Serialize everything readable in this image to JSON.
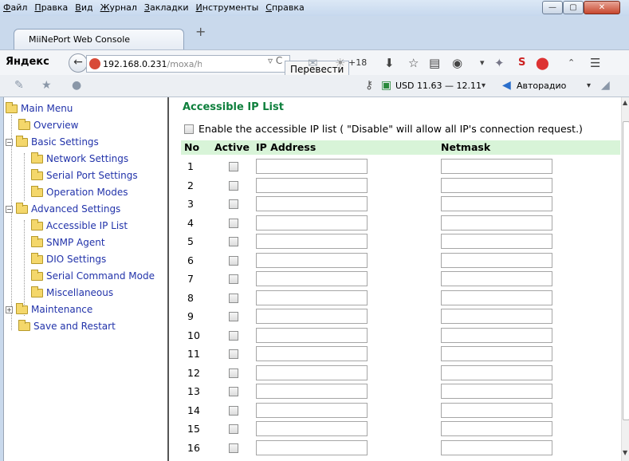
{
  "menu": [
    "Файл",
    "Правка",
    "Вид",
    "Журнал",
    "Закладки",
    "Инструменты",
    "Справка"
  ],
  "window_buttons": {
    "minimize": "—",
    "maximize": "▢",
    "close": "✕"
  },
  "tab": {
    "title": "MiiNePort Web Console",
    "new_tab": "+"
  },
  "nav": {
    "brand": "Яндекс",
    "url_host": "192.168.0.231",
    "url_path": "/moxa/h",
    "translate": "Перевести",
    "reload": "▿ C",
    "weather": "+18"
  },
  "toolbar2": {
    "currency": "USD 11.63 — 12.11",
    "radio": "Авторадио"
  },
  "sidebar": {
    "items": [
      {
        "label": "Main Menu"
      },
      {
        "label": "Overview"
      },
      {
        "label": "Basic Settings"
      },
      {
        "label": "Network Settings"
      },
      {
        "label": "Serial Port Settings"
      },
      {
        "label": "Operation Modes"
      },
      {
        "label": "Advanced Settings"
      },
      {
        "label": "Accessible IP List"
      },
      {
        "label": "SNMP Agent"
      },
      {
        "label": "DIO Settings"
      },
      {
        "label": "Serial Command Mode"
      },
      {
        "label": "Miscellaneous"
      },
      {
        "label": "Maintenance"
      },
      {
        "label": "Save and Restart"
      }
    ]
  },
  "main": {
    "title": "Accessible IP List",
    "enable_label": "Enable the accessible IP list ( \"Disable\" will allow all IP's connection request.)",
    "columns": {
      "no": "No",
      "active": "Active",
      "ip": "IP Address",
      "mask": "Netmask"
    },
    "rows": [
      "1",
      "2",
      "3",
      "4",
      "5",
      "6",
      "7",
      "8",
      "9",
      "10",
      "11",
      "12",
      "13",
      "14",
      "15",
      "16"
    ]
  },
  "colors": {
    "title_green": "#0e7f3c",
    "header_bg": "#d8f4d8",
    "link_blue": "#2233aa"
  }
}
